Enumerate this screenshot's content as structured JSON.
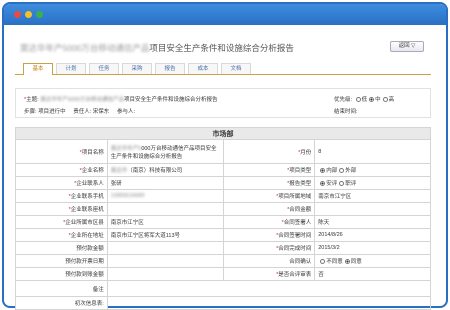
{
  "window": {
    "close_color": "#ea4a3f",
    "minimize_color": "#f5c02c",
    "maximize_color": "#37b24d",
    "accent": "#2f7dd1"
  },
  "header": {
    "title_blurred": "莫达华年产5000万台移动通信产品",
    "title_rest": "项目安全生产条件和设施综合分析报告",
    "back_label": "返回 ▽"
  },
  "tabs": [
    {
      "label": "基本",
      "active": true
    },
    {
      "label": "计划",
      "active": false
    },
    {
      "label": "任务",
      "active": false
    },
    {
      "label": "采购",
      "active": false
    },
    {
      "label": "报告",
      "active": false
    },
    {
      "label": "成本",
      "active": false
    },
    {
      "label": "文档",
      "active": false
    }
  ],
  "info": {
    "subject_label": "主题:",
    "subject_blurred": "莫达华年产5000万台移动通信产品",
    "subject_rest": "项目安全生产条件和设施综合分析报告",
    "steps_label": "步骤:",
    "steps_value": "项目进行中",
    "owner_label": "责任人:",
    "owner_value": "宋保东",
    "participants_label": "参与人:",
    "priority_label": "优先级:",
    "priority_options": [
      "低",
      "中",
      "高"
    ],
    "priority_selected": "中",
    "end_time_label": "结束时间:"
  },
  "form": {
    "section_title": "市场部",
    "rows": [
      {
        "l1": "项目名称",
        "r1": true,
        "v1_blur": "莫达华年产5",
        "v1": "000万台移动通信产品项目安全生产条件和设施综合分析报告",
        "l2": "月份",
        "r2": true,
        "v2": "8"
      },
      {
        "l1": "企业名称",
        "r1": true,
        "v1_blur": "莫达华",
        "v1": "（南京）科技有限公司",
        "l2": "项目类型",
        "r2": true,
        "v2_options": [
          "内部",
          "外部"
        ],
        "v2_selected": "内部"
      },
      {
        "l1": "企业联系人",
        "r1": true,
        "v1": "张研",
        "l2": "报告类型",
        "r2": true,
        "v2_options": [
          "安评",
          "职评"
        ],
        "v2_selected": "安评"
      },
      {
        "l1": "企业联系手机",
        "r1": true,
        "v1_blur": "13955516689",
        "v1": "",
        "l2": "项目所属地域",
        "r2": true,
        "v2": "南京市江宁区"
      },
      {
        "l1": "企业联系座机",
        "r1": true,
        "v1": "",
        "l2": "合同金额",
        "r2": true,
        "v2": ""
      },
      {
        "l1": "企业所属市区县",
        "r1": true,
        "v1": "南京市江宁区",
        "l2": "合同签署人",
        "r2": true,
        "v2": "陈天"
      },
      {
        "l1": "企业所在地址",
        "r1": true,
        "v1": "南京市江宁区将军大道113号",
        "l2": "合同签署时间",
        "r2": true,
        "v2": "2014/8/26"
      },
      {
        "l1": "预付款金额",
        "r1": false,
        "v1": "",
        "l2": "合同完成时间",
        "r2": true,
        "v2": "2015/3/2"
      },
      {
        "l1": "预付款开票日期",
        "r1": false,
        "v1": "",
        "l2": "合同确认",
        "r2": false,
        "v2_options": [
          "不同意",
          "同意"
        ],
        "v2_selected": "同意"
      },
      {
        "l1": "预付款到账金额",
        "r1": false,
        "v1": "",
        "l2": "是否合评审表",
        "r2": true,
        "v2": "否"
      }
    ],
    "remark_label": "备注",
    "initial_info_label": "初次信息表:"
  }
}
